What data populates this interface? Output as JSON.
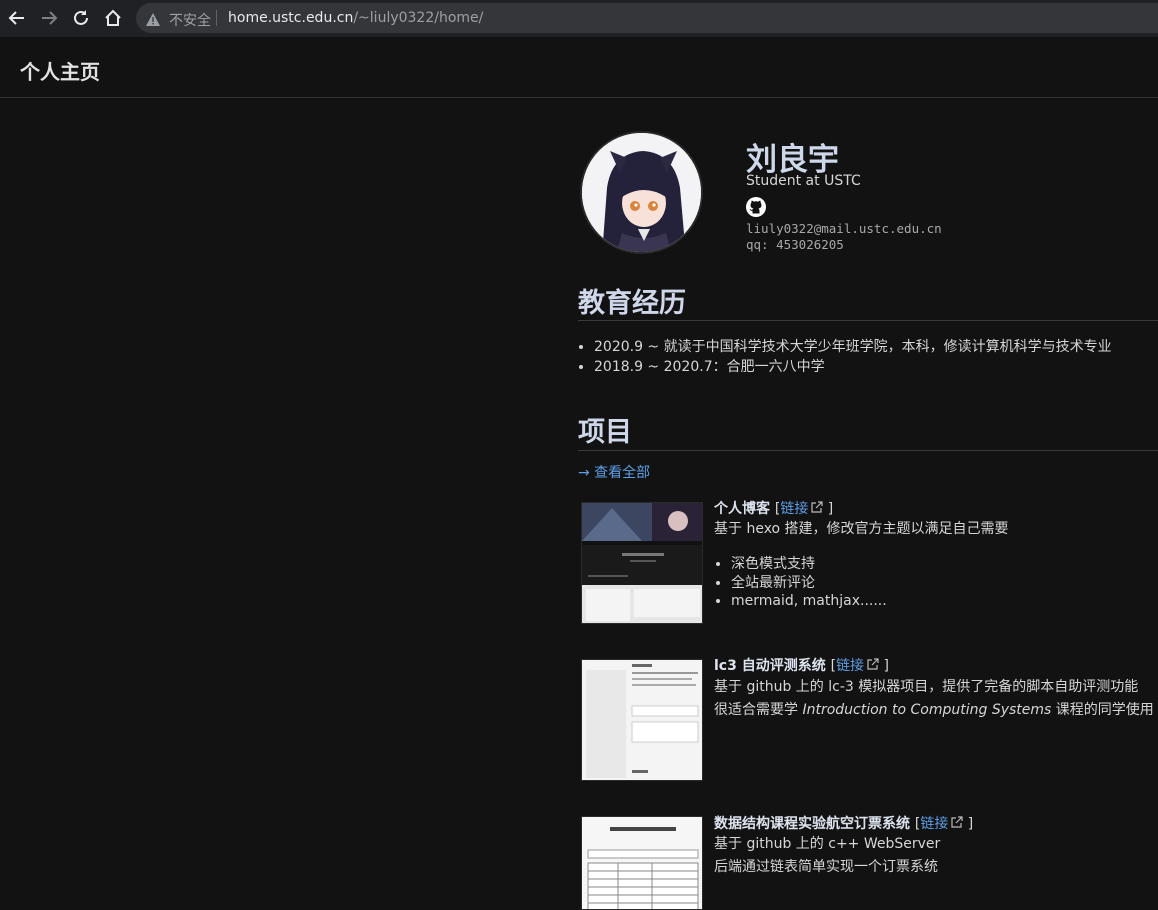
{
  "browser": {
    "insecure_label": "不安全",
    "url_host": "home.ustc.edu.cn",
    "url_path": "/~liuly0322/home/"
  },
  "site": {
    "title": "个人主页"
  },
  "profile": {
    "name": "刘良宇",
    "role": "Student at USTC",
    "email": "liuly0322@mail.ustc.edu.cn",
    "qq": "qq: 453026205"
  },
  "education": {
    "heading": "教育经历",
    "items": [
      "2020.9 ~ 就读于中国科学技术大学少年班学院，本科，修读计算机科学与技术专业",
      "2018.9 ~ 2020.7：合肥一六八中学"
    ]
  },
  "projects": {
    "heading": "项目",
    "view_all": "→ 查看全部",
    "link_label": "链接",
    "items": [
      {
        "title": "个人博客",
        "desc": "基于 hexo 搭建，修改官方主题以满足自己需要",
        "features": [
          "深色模式支持",
          "全站最新评论",
          "mermaid, mathjax......"
        ]
      },
      {
        "title": "lc3 自动评测系统",
        "desc": "基于 github 上的 lc-3 模拟器项目，提供了完备的脚本自助评测功能",
        "desc2_pre": "很适合需要学 ",
        "desc2_em": "Introduction to Computing Systems",
        "desc2_post": " 课程的同学使用"
      },
      {
        "title": "数据结构课程实验航空订票系统",
        "desc": "基于 github 上的 c++ WebServer",
        "desc2": "后端通过链表简单实现一个订票系统"
      }
    ]
  },
  "colors": {
    "accent": "#5c9ee6",
    "heading": "#cfd8ea",
    "background": "#121212"
  }
}
